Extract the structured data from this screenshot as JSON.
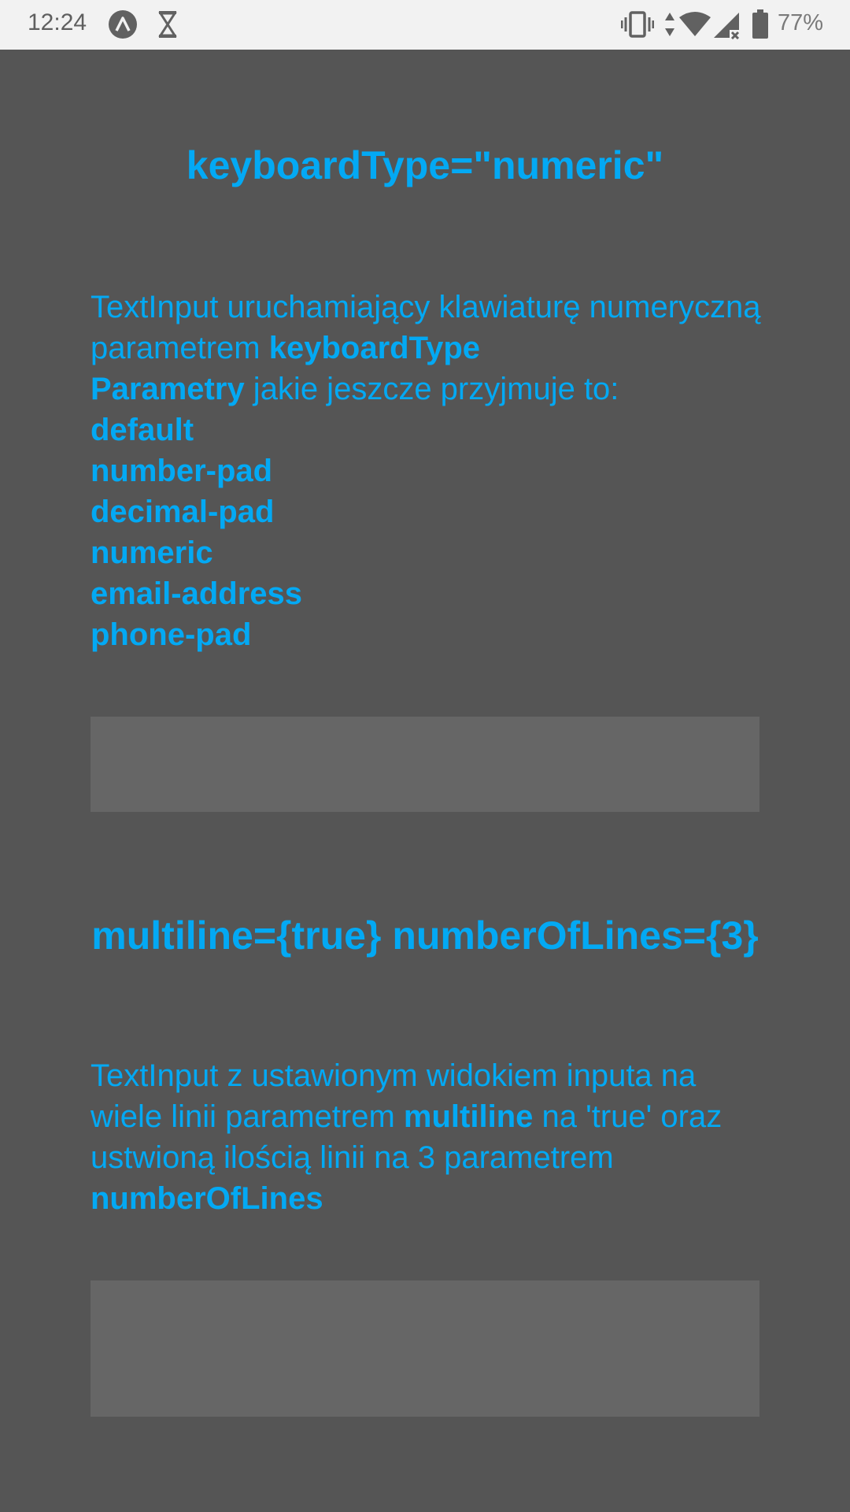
{
  "status_bar": {
    "time": "12:24",
    "battery_percent": "77%",
    "icons": [
      "expo-icon",
      "hourglass-icon",
      "vibrate-icon",
      "data-arrows-icon",
      "wifi-icon",
      "signal-icon",
      "battery-icon"
    ]
  },
  "colors": {
    "background": "#555555",
    "accent": "#03a9f4",
    "input_background": "#666666",
    "status_bar": "#f2f2f2"
  },
  "section_numeric": {
    "heading": "keyboardType=\"numeric\"",
    "desc_part1": "TextInput uruchamiający klawiaturę numeryczną parametrem ",
    "desc_bold1": "keyboardType",
    "desc_bold2": "Parametry",
    "desc_part2": " jakie jeszcze przyjmuje to:",
    "options": [
      "default",
      "number-pad",
      "decimal-pad",
      "numeric",
      "email-address",
      "phone-pad"
    ],
    "input_value": ""
  },
  "section_multiline": {
    "heading": "multiline={true} numberOfLines={3}",
    "desc_part1": "TextInput z ustawionym widokiem inputa na wiele linii parametrem ",
    "desc_bold1": "multiline",
    "desc_part2": " na 'true' oraz ustwioną ilością linii na 3 parametrem ",
    "desc_bold2": "numberOfLines",
    "input_value": ""
  }
}
